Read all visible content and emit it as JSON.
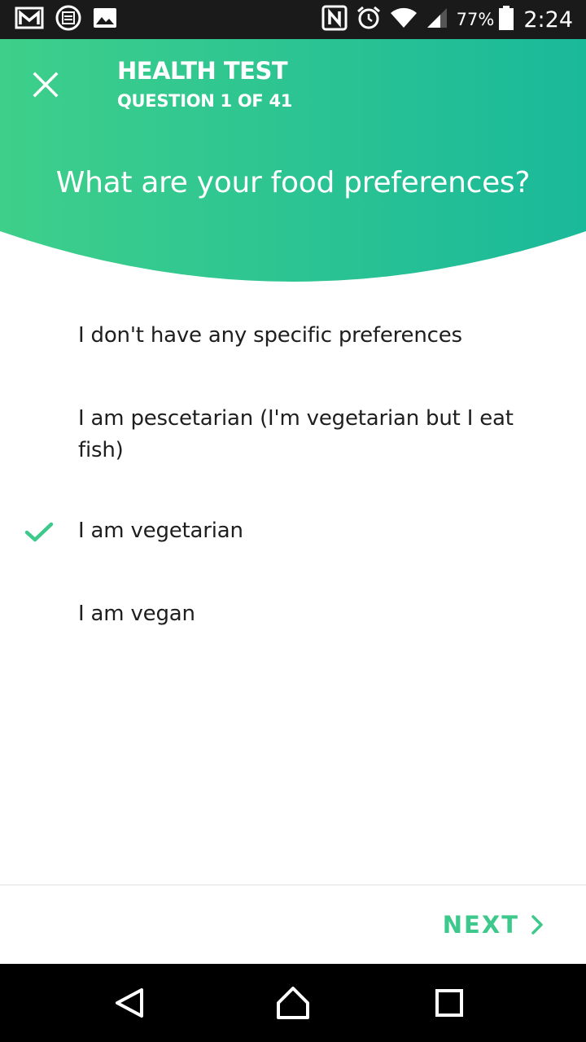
{
  "status_bar": {
    "battery_percent": "77%",
    "time": "2:24",
    "icons": [
      "gmail-icon",
      "stack-exchange-icon",
      "gallery-icon",
      "nfc-icon",
      "alarm-icon",
      "wifi-icon",
      "signal-icon",
      "battery-icon"
    ]
  },
  "header": {
    "title": "HEALTH TEST",
    "progress": "QUESTION 1 OF 41",
    "close_icon": "close-icon",
    "gradient_start": "#3ecf8a",
    "gradient_end": "#1ab99a"
  },
  "question": {
    "text": "What are your food preferences?"
  },
  "options": [
    {
      "label": "I don't have any specific preferences",
      "selected": false
    },
    {
      "label": "I am pescetarian (I'm vegetarian but I eat fish)",
      "selected": false
    },
    {
      "label": "I am vegetarian",
      "selected": true
    },
    {
      "label": "I am vegan",
      "selected": false
    }
  ],
  "footer": {
    "next_label": "NEXT",
    "accent": "#3dc88c"
  },
  "nav_bar": {
    "buttons": [
      "back-icon",
      "home-icon",
      "recents-icon"
    ]
  }
}
